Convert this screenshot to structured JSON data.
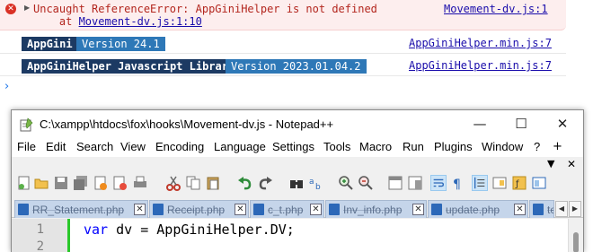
{
  "console": {
    "error": {
      "arrow": "▶",
      "message": "Uncaught ReferenceError: AppGiniHelper is not defined",
      "stack_prefix": "    at ",
      "stack_link": "Movement-dv.js:1:10",
      "source": "Movement-dv.js:1"
    },
    "logs": [
      {
        "badge1": "AppGini",
        "badge2": "Version 24.1",
        "source": "AppGiniHelper.min.js:7"
      },
      {
        "badge1": "AppGiniHelper Javascript Library",
        "badge2": "Version 2023.01.04.2",
        "source": "AppGiniHelper.min.js:7"
      }
    ],
    "prompt": "›"
  },
  "notepad": {
    "title": "C:\\xampp\\htdocs\\fox\\hooks\\Movement-dv.js - Notepad++",
    "window_buttons": {
      "minimize": "—",
      "maximize": "☐",
      "close": "✕"
    },
    "menu": [
      "File",
      "Edit",
      "Search",
      "View",
      "Encoding",
      "Language",
      "Settings",
      "Tools",
      "Macro",
      "Run",
      "Plugins",
      "Window",
      "?"
    ],
    "menu_plus": "+",
    "menu_down": "▼",
    "menu_close": "✕",
    "tabs": [
      {
        "label": "RR_Statement.php"
      },
      {
        "label": "Receipt.php"
      },
      {
        "label": "c_t.php"
      },
      {
        "label": "Inv_info.php"
      },
      {
        "label": "update.php"
      },
      {
        "label": "test"
      }
    ],
    "tab_scroll": {
      "left": "◀",
      "right": "▶"
    },
    "editor": {
      "line_numbers": [
        "1",
        "2"
      ],
      "line1_keyword": "var",
      "line1_rest": " dv = AppGiniHelper.DV;"
    }
  },
  "colors": {
    "error_bg": "#fdeeee",
    "error_text": "#b3261e",
    "badge_dark": "#1c3a63",
    "badge_light": "#2e78b7",
    "link": "#1a0dab",
    "tab_bg": "#c5d5ea",
    "keyword": "#0000ff",
    "change_bar": "#2ac82a"
  }
}
